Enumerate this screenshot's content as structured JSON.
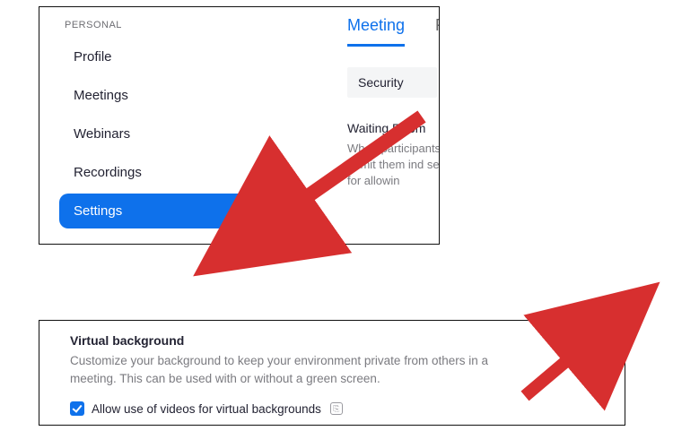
{
  "sidebar": {
    "section_label": "PERSONAL",
    "items": [
      {
        "label": "Profile"
      },
      {
        "label": "Meetings"
      },
      {
        "label": "Webinars"
      },
      {
        "label": "Recordings"
      },
      {
        "label": "Settings"
      }
    ]
  },
  "tabs": {
    "items": [
      {
        "label": "Meeting"
      },
      {
        "label": "Re"
      }
    ]
  },
  "subnav": {
    "label": "Security"
  },
  "waiting_room": {
    "title": "Waiting Room",
    "desc": "When participants to admit them ind setting for allowin"
  },
  "virtual_bg": {
    "title": "Virtual background",
    "desc": "Customize your background to keep your environment private from others in a meeting. This can be used with or without a green screen.",
    "checkbox_label": "Allow use of videos for virtual backgrounds"
  }
}
